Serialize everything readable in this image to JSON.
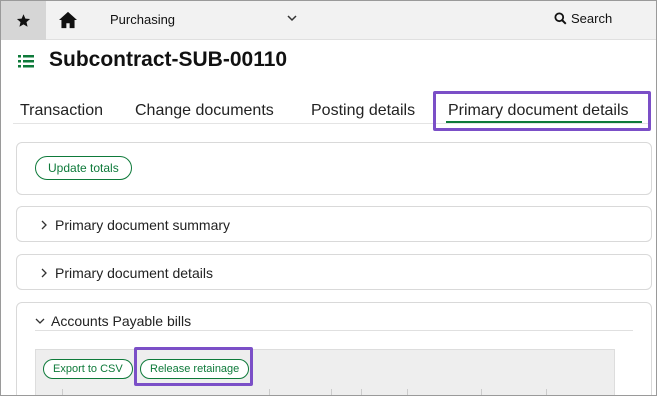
{
  "topbar": {
    "module": "Purchasing",
    "search_label": "Search"
  },
  "page": {
    "title": "Subcontract-SUB-00110"
  },
  "tabs": [
    {
      "label": "Transaction"
    },
    {
      "label": "Change documents"
    },
    {
      "label": "Posting details"
    },
    {
      "label": "Primary document details",
      "active": true
    }
  ],
  "actions": {
    "update_totals": "Update totals"
  },
  "sections": {
    "summary": "Primary document summary",
    "details": "Primary document details",
    "ap_bills": "Accounts Payable bills"
  },
  "grid_toolbar": {
    "export_csv": "Export to CSV",
    "release_retainage": "Release retainage"
  },
  "colors": {
    "accent_green": "#0e7a3a",
    "highlight_purple": "#7b4fc7"
  }
}
